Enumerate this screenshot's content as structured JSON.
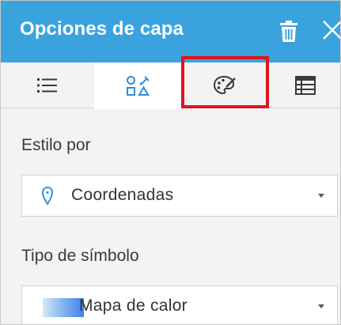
{
  "panel": {
    "title": "Opciones de capa"
  },
  "icons": {
    "trash": "trash-icon",
    "close": "close-icon",
    "tabs": [
      "list-icon",
      "shapes-style-icon",
      "palette-icon",
      "table-icon"
    ]
  },
  "tabs": {
    "active_index": 1,
    "highlighted_index": 2
  },
  "style_by": {
    "label": "Estilo por",
    "value": "Coordenadas"
  },
  "symbol_type": {
    "label": "Tipo de símbolo",
    "value": "Mapa de calor"
  },
  "colors": {
    "header": "#3aa3dd",
    "highlight": "#e0141e",
    "accent": "#3a8fd6"
  }
}
